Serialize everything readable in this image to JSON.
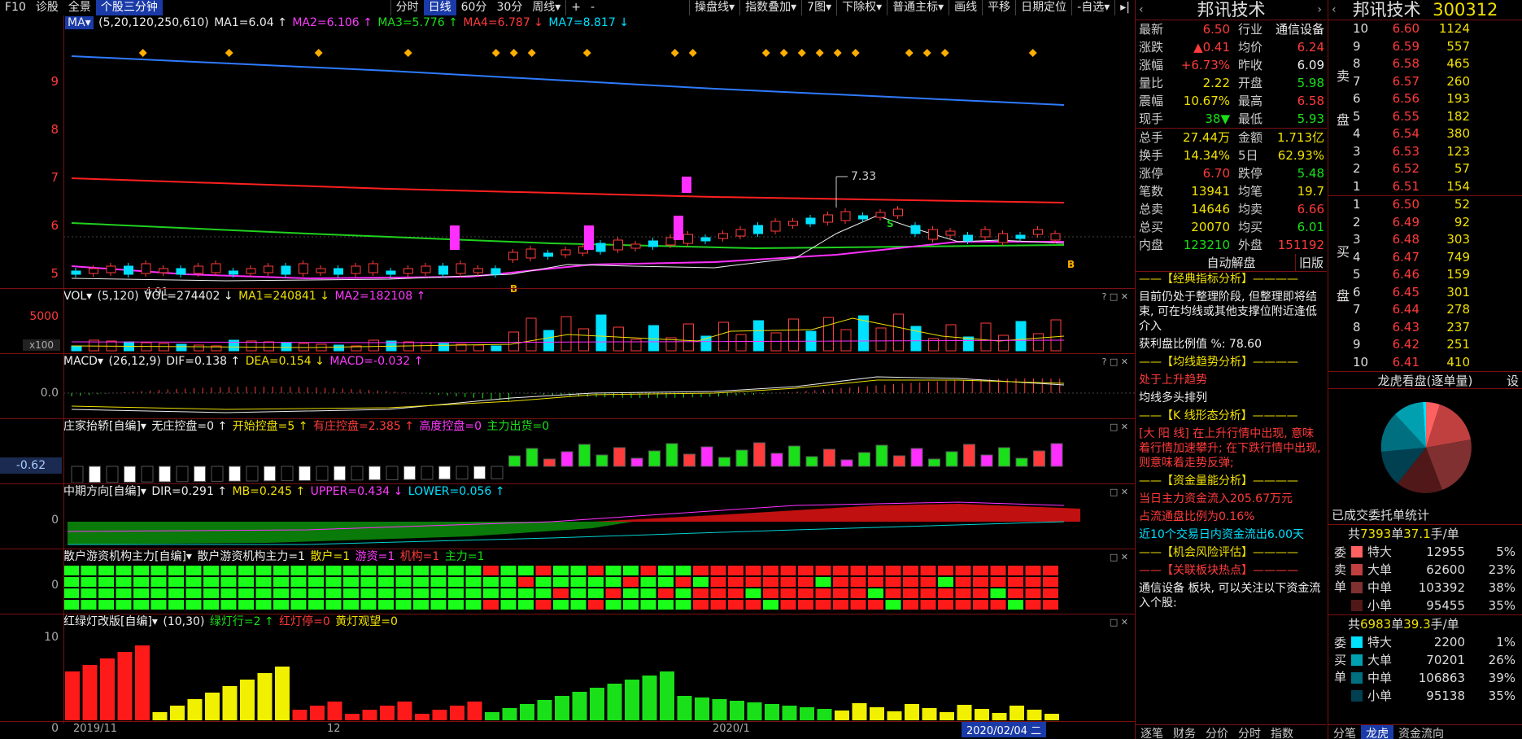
{
  "toolbar": {
    "left": [
      "F10",
      "诊股",
      "全景",
      "个股三分钟"
    ],
    "periods": [
      "分时",
      "日线",
      "60分",
      "30分",
      "周线▾"
    ],
    "zoom": [
      "+",
      "-"
    ],
    "tools": [
      "操盘线▾",
      "指数叠加▾",
      "7图▾",
      "下除权▾",
      "普通主标▾",
      "画线",
      "平移",
      "日期定位",
      "-自选▾",
      "▸|"
    ]
  },
  "main_panel": {
    "ma_label": "MA▾",
    "params": "(5,20,120,250,610)",
    "ma1": "MA1=6.04 ↑",
    "ma2": "MA2=6.106 ↑",
    "ma3": "MA3=5.776 ↑",
    "ma4": "MA4=6.787 ↓",
    "ma7": "MA7=8.817 ↓",
    "y_labels": [
      "9",
      "8",
      "7",
      "6",
      "5"
    ],
    "high_label": "7.33",
    "low_label": "4.91",
    "b_marks": [
      "B",
      "B"
    ],
    "s_mark": "S"
  },
  "vol_panel": {
    "label": "VOL▾",
    "params": "(5,120)",
    "vol": "VOL=274402 ↓",
    "ma1": "MA1=240841 ↓",
    "ma2": "MA2=182108 ↑",
    "y_label": "5000",
    "unit": "x100"
  },
  "macd_panel": {
    "label": "MACD▾",
    "params": "(26,12,9)",
    "dif": "DIF=0.138 ↑",
    "dea": "DEA=0.154 ↓",
    "macd": "MACD=-0.032 ↑",
    "y_label": "0.0"
  },
  "zhuang_panel": {
    "label": "庄家抬轿[自编]▾",
    "a": "无庄控盘=0 ↑",
    "b": "开始控盘=5 ↑",
    "c": "有庄控盘=2.385 ↑",
    "d": "高度控盘=0",
    "e": "主力出货=0",
    "y_value": "-0.62"
  },
  "dir_panel": {
    "label": "中期方向[自编]▾",
    "dir": "DIR=0.291 ↑",
    "mb": "MB=0.245 ↑",
    "upper": "UPPER=0.434 ↓",
    "lower": "LOWER=0.056 ↑",
    "y_label": "0"
  },
  "sanhu_panel": {
    "label": "散户游资机构主力[自编]▾",
    "a": "散户游资机构主力=1",
    "b": "散户=1",
    "c": "游资=1",
    "d": "机构=1",
    "e": "主力=1",
    "y_label": "0"
  },
  "light_panel": {
    "label": "红绿灯改版[自编]▾",
    "params": "(10,30)",
    "g": "绿灯行=2 ↑",
    "r": "红灯停=0",
    "y": "黄灯观望=0",
    "y_top": "10",
    "y_bottom": "0"
  },
  "date_axis": [
    "2019/11",
    "12",
    "2020/1",
    "2020/02/04 二"
  ],
  "quote": {
    "name": "邦讯技术",
    "rows": [
      {
        "k": "最新",
        "v": "6.50",
        "vc": "red",
        "k2": "行业",
        "v2": "通信设备",
        "v2c": "white"
      },
      {
        "k": "涨跌",
        "v": "▲0.41",
        "vc": "red",
        "k2": "均价",
        "v2": "6.24",
        "v2c": "red"
      },
      {
        "k": "涨幅",
        "v": "+6.73%",
        "vc": "red",
        "k2": "昨收",
        "v2": "6.09",
        "v2c": "white"
      },
      {
        "k": "量比",
        "v": "2.22",
        "vc": "yellow",
        "k2": "开盘",
        "v2": "5.98",
        "v2c": "green"
      },
      {
        "k": "震幅",
        "v": "10.67%",
        "vc": "yellow",
        "k2": "最高",
        "v2": "6.58",
        "v2c": "red"
      },
      {
        "k": "现手",
        "v": "38▼",
        "vc": "green",
        "k2": "最低",
        "v2": "5.93",
        "v2c": "green"
      }
    ],
    "rows2": [
      {
        "k": "总手",
        "v": "27.44万",
        "vc": "yellow",
        "k2": "金额",
        "v2": "1.713亿",
        "v2c": "yellow"
      },
      {
        "k": "换手",
        "v": "14.34%",
        "vc": "yellow",
        "k2": "5日",
        "v2": "62.93%",
        "v2c": "yellow"
      },
      {
        "k": "涨停",
        "v": "6.70",
        "vc": "red",
        "k2": "跌停",
        "v2": "5.48",
        "v2c": "green"
      },
      {
        "k": "笔数",
        "v": "13941",
        "vc": "yellow",
        "k2": "均笔",
        "v2": "19.7",
        "v2c": "yellow"
      },
      {
        "k": "总卖",
        "v": "14646",
        "vc": "yellow",
        "k2": "均卖",
        "v2": "6.66",
        "v2c": "red"
      },
      {
        "k": "总买",
        "v": "20070",
        "vc": "yellow",
        "k2": "均买",
        "v2": "6.01",
        "v2c": "green"
      },
      {
        "k": "内盘",
        "v": "123210",
        "vc": "green",
        "k2": "外盘",
        "v2": "151192",
        "v2c": "red"
      }
    ],
    "auto_title": "自动解盘",
    "old_version": "旧版",
    "analysis": [
      {
        "t": "——【经典指标分析】————",
        "c": "yellow"
      },
      {
        "t": "目前仍处于整理阶段, 但整理即将结束, 可在均线或其他支撑位附近逢低介入",
        "c": "white"
      },
      {
        "t": "获利盘比例值 %: 78.60",
        "c": "white"
      },
      {
        "t": "——【均线趋势分析】————",
        "c": "yellow"
      },
      {
        "t": "处于上升趋势",
        "c": "red"
      },
      {
        "t": "均线多头排列",
        "c": "white"
      },
      {
        "t": "——【K 线形态分析】————",
        "c": "yellow"
      },
      {
        "t": "[大 阳 线] 在上升行情中出现, 意味着行情加速攀升; 在下跌行情中出现, 则意味着走势反弹;",
        "c": "red"
      },
      {
        "t": "——【资金量能分析】————",
        "c": "yellow"
      },
      {
        "t": "当日主力资金流入205.67万元",
        "c": "red"
      },
      {
        "t": "占流通盘比例为0.16%",
        "c": "red"
      },
      {
        "t": "近10个交易日内资金流出6.00天",
        "c": "cyan"
      },
      {
        "t": "——【机会风险评估】————",
        "c": "yellow"
      },
      {
        "t": "——【关联板块热点】————",
        "c": "red"
      },
      {
        "t": "通信设备 板块, 可以关注以下资金流入个股:",
        "c": "white"
      }
    ],
    "tabs": [
      "逐笔",
      "财务",
      "分价",
      "分时",
      "指数"
    ]
  },
  "orderbook": {
    "name": "邦讯技术",
    "code": "300312",
    "sell_side": "卖盘",
    "buy_side": "买盘",
    "sells": [
      {
        "l": "10",
        "p": "6.60",
        "v": "1124"
      },
      {
        "l": "9",
        "p": "6.59",
        "v": "557"
      },
      {
        "l": "8",
        "p": "6.58",
        "v": "465"
      },
      {
        "l": "7",
        "p": "6.57",
        "v": "260"
      },
      {
        "l": "6",
        "p": "6.56",
        "v": "193"
      },
      {
        "l": "5",
        "p": "6.55",
        "v": "182"
      },
      {
        "l": "4",
        "p": "6.54",
        "v": "380"
      },
      {
        "l": "3",
        "p": "6.53",
        "v": "123"
      },
      {
        "l": "2",
        "p": "6.52",
        "v": "57"
      },
      {
        "l": "1",
        "p": "6.51",
        "v": "154"
      }
    ],
    "buys": [
      {
        "l": "1",
        "p": "6.50",
        "v": "52"
      },
      {
        "l": "2",
        "p": "6.49",
        "v": "92"
      },
      {
        "l": "3",
        "p": "6.48",
        "v": "303"
      },
      {
        "l": "4",
        "p": "6.47",
        "v": "749"
      },
      {
        "l": "5",
        "p": "6.46",
        "v": "159"
      },
      {
        "l": "6",
        "p": "6.45",
        "v": "301"
      },
      {
        "l": "7",
        "p": "6.44",
        "v": "278"
      },
      {
        "l": "8",
        "p": "6.43",
        "v": "237"
      },
      {
        "l": "9",
        "p": "6.42",
        "v": "251"
      },
      {
        "l": "10",
        "p": "6.41",
        "v": "410"
      }
    ],
    "dragon_title": "龙虎看盘(逐单量)",
    "settings": "设",
    "done_title": "已成交委托单统计",
    "sell_summary": {
      "prefix": "共",
      "count": "7393",
      "mid": "单",
      "avg": "37.1",
      "suffix": "手/单"
    },
    "buy_summary": {
      "prefix": "共",
      "count": "6983",
      "mid": "单",
      "avg": "39.3",
      "suffix": "手/单"
    },
    "sell_label": "委卖单",
    "buy_label": "委买单",
    "sell_stats": [
      {
        "n": "特大",
        "c": "12955",
        "p": "5%",
        "col": "#ff6060"
      },
      {
        "n": "大单",
        "c": "62600",
        "p": "23%",
        "col": "#c04040"
      },
      {
        "n": "中单",
        "c": "103392",
        "p": "38%",
        "col": "#803030"
      },
      {
        "n": "小单",
        "c": "95455",
        "p": "35%",
        "col": "#501818"
      }
    ],
    "buy_stats": [
      {
        "n": "特大",
        "c": "2200",
        "p": "1%",
        "col": "#00e0ff"
      },
      {
        "n": "大单",
        "c": "70201",
        "p": "26%",
        "col": "#00a0b0"
      },
      {
        "n": "中单",
        "c": "106863",
        "p": "39%",
        "col": "#007080"
      },
      {
        "n": "小单",
        "c": "95138",
        "p": "35%",
        "col": "#004050"
      }
    ],
    "tabs": [
      "分笔",
      "龙虎",
      "资金流向"
    ]
  }
}
